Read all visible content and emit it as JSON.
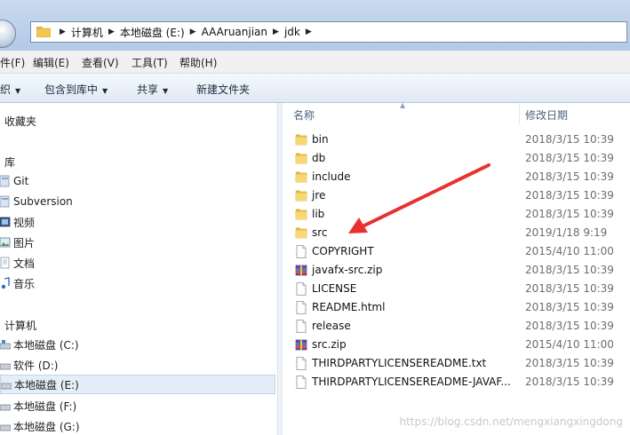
{
  "address": {
    "crumbs": [
      "计算机",
      "本地磁盘 (E:)",
      "AAAruanjian",
      "jdk"
    ],
    "separator": "▶"
  },
  "menu": [
    {
      "label": "件(F)"
    },
    {
      "label": "编辑(E)"
    },
    {
      "label": "查看(V)"
    },
    {
      "label": "工具(T)"
    },
    {
      "label": "帮助(H)"
    }
  ],
  "toolbar": [
    {
      "label": "织",
      "has_dropdown": true
    },
    {
      "label": "包含到库中",
      "has_dropdown": true
    },
    {
      "label": "共享",
      "has_dropdown": true
    },
    {
      "label": "新建文件夹",
      "has_dropdown": false
    }
  ],
  "nav": {
    "favorites": "收藏夹",
    "libraries": "库",
    "library_items": [
      {
        "label": "Git",
        "icon": "library-icon"
      },
      {
        "label": "Subversion",
        "icon": "library-icon"
      },
      {
        "label": "视频",
        "icon": "video-icon"
      },
      {
        "label": "图片",
        "icon": "picture-icon"
      },
      {
        "label": "文档",
        "icon": "document-icon"
      },
      {
        "label": "音乐",
        "icon": "music-icon"
      }
    ],
    "computer": "计算机",
    "drives": [
      {
        "label": "本地磁盘 (C:)",
        "selected": false
      },
      {
        "label": "软件 (D:)",
        "selected": false
      },
      {
        "label": "本地磁盘 (E:)",
        "selected": true
      },
      {
        "label": "本地磁盘 (F:)",
        "selected": false
      },
      {
        "label": "本地磁盘 (G:)",
        "selected": false
      }
    ]
  },
  "files": {
    "columns": {
      "name": "名称",
      "modified": "修改日期"
    },
    "rows": [
      {
        "name": "bin",
        "modified": "2018/3/15 10:39",
        "icon": "folder-icon"
      },
      {
        "name": "db",
        "modified": "2018/3/15 10:39",
        "icon": "folder-icon"
      },
      {
        "name": "include",
        "modified": "2018/3/15 10:39",
        "icon": "folder-icon"
      },
      {
        "name": "jre",
        "modified": "2018/3/15 10:39",
        "icon": "folder-icon"
      },
      {
        "name": "lib",
        "modified": "2018/3/15 10:39",
        "icon": "folder-icon"
      },
      {
        "name": "src",
        "modified": "2019/1/18 9:19",
        "icon": "folder-icon"
      },
      {
        "name": "COPYRIGHT",
        "modified": "2015/4/10 11:00",
        "icon": "file-icon"
      },
      {
        "name": "javafx-src.zip",
        "modified": "2018/3/15 10:39",
        "icon": "archive-icon"
      },
      {
        "name": "LICENSE",
        "modified": "2018/3/15 10:39",
        "icon": "file-icon"
      },
      {
        "name": "README.html",
        "modified": "2018/3/15 10:39",
        "icon": "file-icon"
      },
      {
        "name": "release",
        "modified": "2018/3/15 10:39",
        "icon": "file-icon"
      },
      {
        "name": "src.zip",
        "modified": "2015/4/10 11:00",
        "icon": "archive-icon"
      },
      {
        "name": "THIRDPARTYLICENSEREADME.txt",
        "modified": "2018/3/15 10:39",
        "icon": "file-icon"
      },
      {
        "name": "THIRDPARTYLICENSEREADME-JAVAF...",
        "modified": "2018/3/15 10:39",
        "icon": "file-icon"
      }
    ]
  },
  "watermark": "https://blog.csdn.net/mengxiangxingdong",
  "colors": {
    "annotation_arrow": "#e8312f",
    "folder": "#f2c851",
    "selection": "#e4eef9"
  }
}
